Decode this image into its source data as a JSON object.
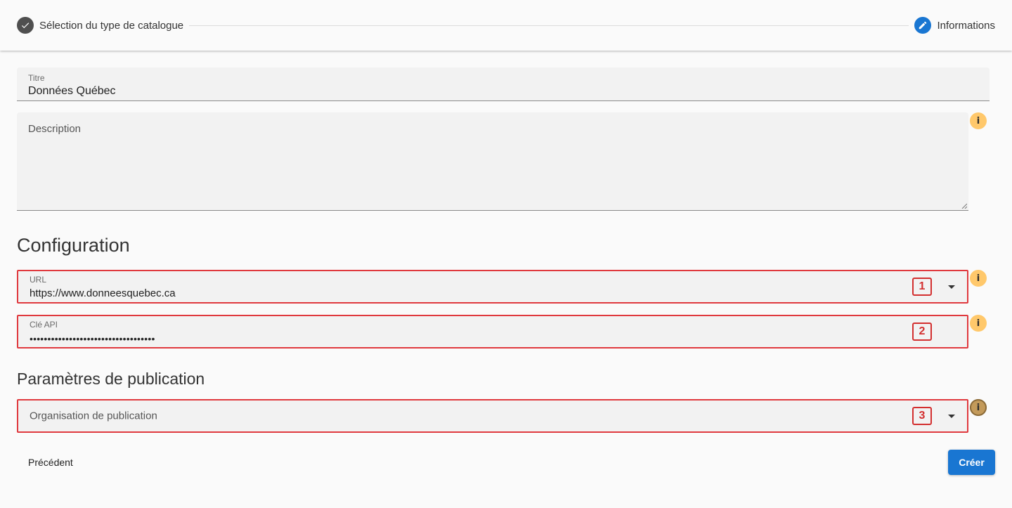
{
  "stepper": {
    "steps": [
      {
        "label": "Sélection du type de catalogue",
        "state": "done"
      },
      {
        "label": "Informations",
        "state": "active"
      }
    ]
  },
  "form": {
    "title": {
      "label": "Titre",
      "value": "Données Québec"
    },
    "description": {
      "placeholder": "Description",
      "value": ""
    },
    "configuration_heading": "Configuration",
    "url": {
      "label": "URL",
      "value": "https://www.donneesquebec.ca",
      "badge": "1"
    },
    "api_key": {
      "label": "Clé API",
      "value": "•••••••••••••••••••••••••••••••••••",
      "badge": "2"
    },
    "publication_heading": "Paramètres de publication",
    "organisation": {
      "placeholder": "Organisation de publication",
      "badge": "3"
    }
  },
  "actions": {
    "previous_label": "Précédent",
    "create_label": "Créer"
  },
  "info_icon_glyph": "i",
  "colors": {
    "primary": "#1976d2",
    "highlight": "#e0393e",
    "info": "#ffc86b"
  }
}
